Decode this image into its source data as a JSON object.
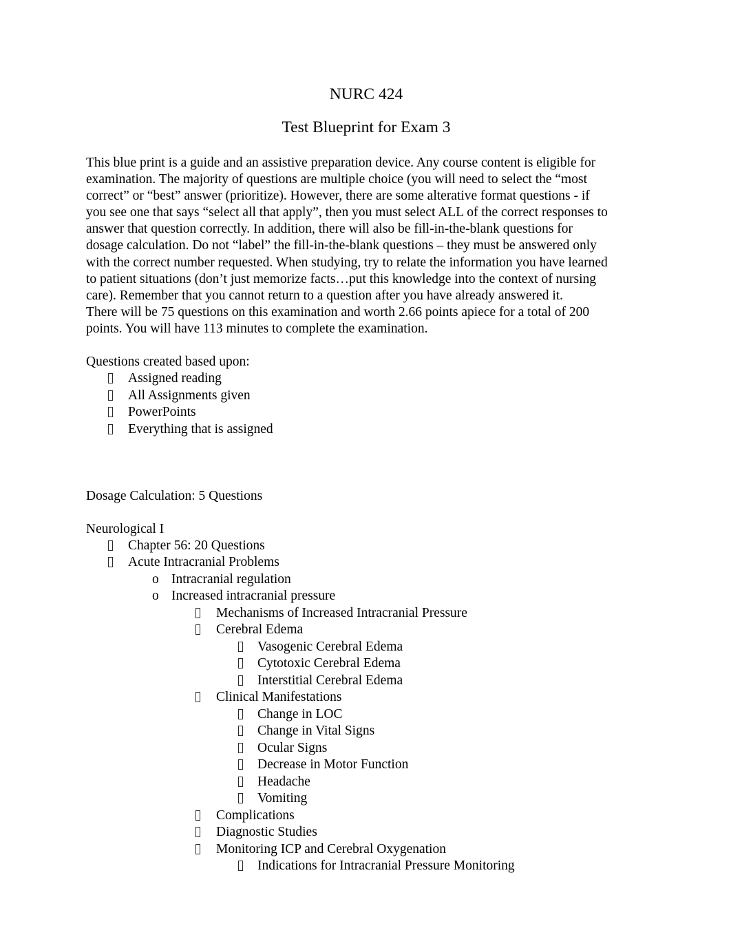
{
  "document": {
    "title_line_1": "NURC 424",
    "title_line_2": "Test Blueprint for Exam 3",
    "intro_paragraph": {
      "lines": [
        "This blue print is a guide and an assistive preparation device. Any course content is eligible for",
        "examination. The majority of questions are multiple choice (you will need to select the “most",
        "correct” or “best” answer (prioritize).  However, there are some alterative format questions - if",
        "you see one that says “select all that apply”, then you must select ALL of the correct responses to",
        "answer that question correctly.  In addition, there will also be fill-in-the-blank questions for",
        "dosage calculation.  Do not “label” the fill-in-the-blank questions – they must be answered only",
        "with the correct number requested. When studying, try to relate the information you have learned",
        "to patient situations (don’t just memorize facts…put this knowledge into the context of nursing",
        "care).  Remember that you cannot return to a question after you have already answered it.",
        "There will be 75 questions on this examination and worth 2.66 points apiece for a total of 200",
        "points.  You will have 113 minutes to complete the examination."
      ]
    },
    "questions_heading": "Questions created based upon:",
    "questions_items": [
      "Assigned reading",
      "All Assignments given",
      "PowerPoints",
      "Everything that is assigned"
    ],
    "dosage_line": "Dosage Calculation: 5 Questions",
    "section_heading": "Neurological I",
    "outline": [
      {
        "level": 1,
        "bullet": "tofu",
        "text": "Chapter 56: 20 Questions"
      },
      {
        "level": 1,
        "bullet": "tofu",
        "text": "Acute Intracranial Problems"
      },
      {
        "level": 2,
        "bullet": "o",
        "text": "Intracranial regulation"
      },
      {
        "level": 2,
        "bullet": "o",
        "text": "Increased intracranial pressure"
      },
      {
        "level": 3,
        "bullet": "tofu",
        "text": "Mechanisms of Increased Intracranial Pressure"
      },
      {
        "level": 3,
        "bullet": "tofu",
        "text": "Cerebral Edema"
      },
      {
        "level": 4,
        "bullet": "tofu",
        "text": "Vasogenic Cerebral Edema"
      },
      {
        "level": 4,
        "bullet": "tofu",
        "text": "Cytotoxic Cerebral Edema"
      },
      {
        "level": 4,
        "bullet": "tofu",
        "text": "Interstitial Cerebral Edema"
      },
      {
        "level": 3,
        "bullet": "tofu",
        "text": "Clinical Manifestations"
      },
      {
        "level": 4,
        "bullet": "tofu",
        "text": "Change in LOC"
      },
      {
        "level": 4,
        "bullet": "tofu",
        "text": "Change in Vital Signs"
      },
      {
        "level": 4,
        "bullet": "tofu",
        "text": "Ocular Signs"
      },
      {
        "level": 4,
        "bullet": "tofu",
        "text": "Decrease in Motor Function"
      },
      {
        "level": 4,
        "bullet": "tofu",
        "text": "Headache"
      },
      {
        "level": 4,
        "bullet": "tofu",
        "text": "Vomiting"
      },
      {
        "level": 3,
        "bullet": "tofu",
        "text": "Complications"
      },
      {
        "level": 3,
        "bullet": "tofu",
        "text": "Diagnostic Studies"
      },
      {
        "level": 3,
        "bullet": "tofu",
        "text": "Monitoring ICP and Cerebral Oxygenation"
      },
      {
        "level": 4,
        "bullet": "tofu",
        "text": "Indications for Intracranial Pressure Monitoring"
      }
    ],
    "colors": {
      "page_background": "#ffffff",
      "text": "#000000"
    }
  }
}
